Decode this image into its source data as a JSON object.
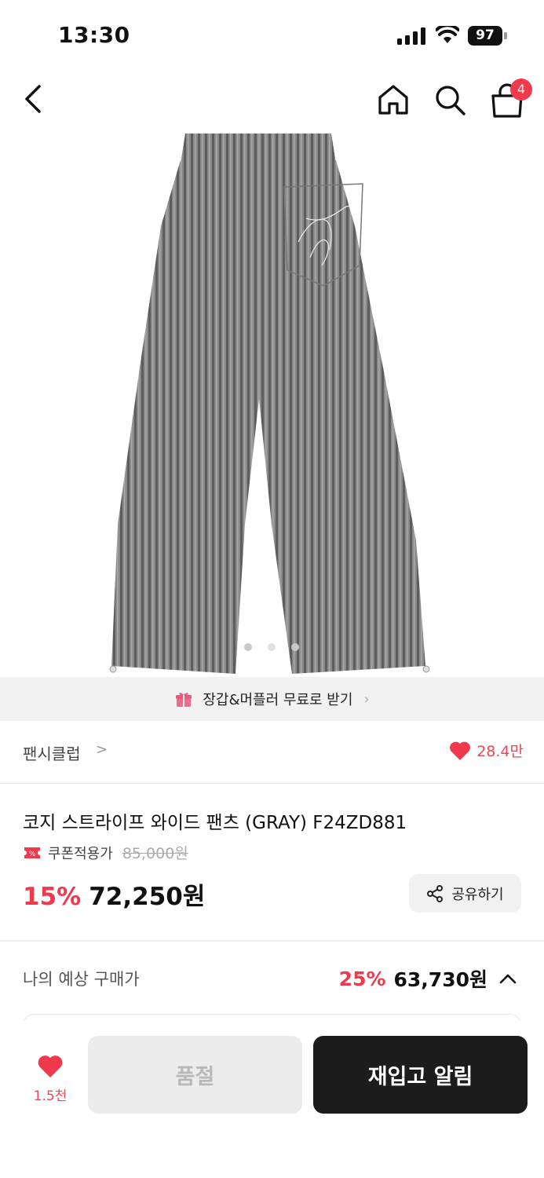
{
  "status_bar": {
    "time": "13:30",
    "battery": "97",
    "icons": [
      "signal-icon",
      "wifi-icon",
      "battery-icon"
    ]
  },
  "nav": {
    "icons": [
      "back-icon",
      "home-icon",
      "search-icon",
      "shopping-bag-icon"
    ],
    "cart_count": "4"
  },
  "product_image": {
    "slide_count": 3,
    "active_slide": 2
  },
  "promo": {
    "text": "장갑&머플러 무료로 받기",
    "chevron": "›"
  },
  "brand": {
    "name": "팬시클럽",
    "chevron": ">",
    "like_count": "28.4만"
  },
  "product": {
    "title": "코지 스트라이프 와이드 팬츠 (GRAY) F24ZD881",
    "coupon_label": "쿠폰적용가",
    "original_price": "85,000원",
    "discount": "15%",
    "price": "72,250원",
    "share_label": "공유하기"
  },
  "estimate": {
    "label": "나의 예상 구매가",
    "discount": "25%",
    "price": "63,730원"
  },
  "bottom_bar": {
    "wish_count": "1.5천",
    "soldout_label": "품절",
    "restock_label": "재입고 알림"
  },
  "colors": {
    "accent": "#f1394d",
    "heart": "#e84a55",
    "dark_button": "#1c1c1c",
    "disabled_button": "#ececec"
  }
}
